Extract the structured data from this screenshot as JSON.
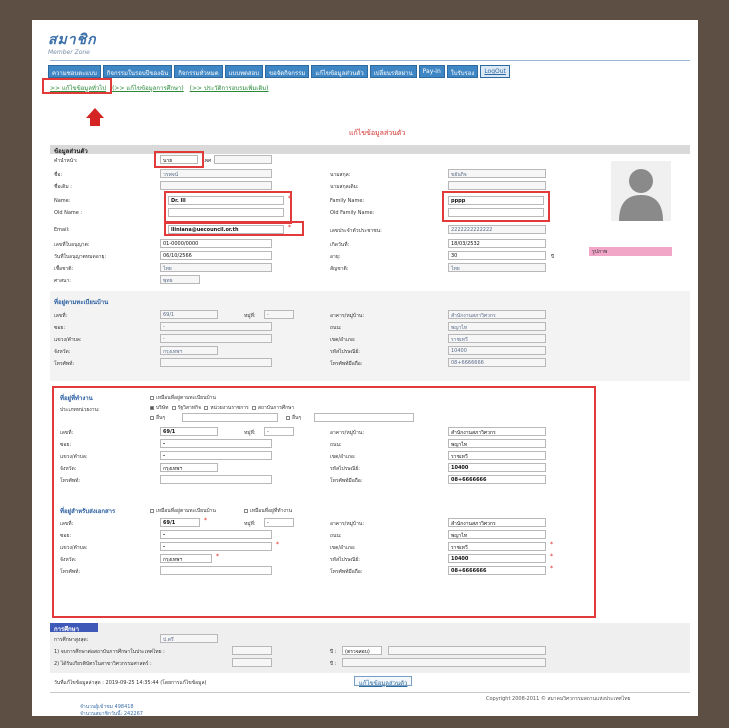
{
  "logo": {
    "title": "สมาชิก",
    "subtitle": "Member Zone"
  },
  "nav": [
    "ความชอบตะแบบ",
    "กิจกรรมในรอบปีของฉัน",
    "กิจกรรมทั่วหมด",
    "แบบทดสอบ",
    "ขอจัดกิจกรรม",
    "แก้ไขข้อมูลส่วนตัว",
    "เปลี่ยนรหัสผ่าน",
    "Pay-in",
    "ใบรับรอง",
    "LogOut"
  ],
  "subtabs": [
    ">> แก้ไขข้อมูลทั่วไป",
    "(>> แก้ไขข้อมูลการศึกษา)",
    "(>> ประวัติการอบรมเพิ่มเติม)"
  ],
  "heading": "แก้ไขข้อมูลส่วนตัว",
  "personal": {
    "section": "ข้อมูลส่วนตัว",
    "prefix_label": "คำนำหน้า:",
    "prefix_value": "นาย",
    "sex_label": "เพศ",
    "name_th_label": "ชื่อ:",
    "name_th_value": "วรพจน์",
    "lastname_th_label": "นามสกุล:",
    "lastname_th_value": "ขยันกิจ",
    "name_en_label2": "ชื่อเดิม :",
    "lastname_en_label2": "นามสกุลเดิม:",
    "name_label": "Name:",
    "name_value": "Dr.   lll",
    "family_label": "Family Name:",
    "family_value": "pppp",
    "oldname_label": "Old Name :",
    "oldfamily_label": "Old Family Name:",
    "email_label": "Email:",
    "email_value": "lliniana@uecouncil.or.th",
    "idcard_label": "เลขประจำตัวประชาชน:",
    "idcard_value": "2222222222222",
    "member_no_label": "เลขที่ใบอนุญาต:",
    "member_no_value": "01-0000/0000",
    "birth_label": "เกิดวันที่:",
    "birth_value": "18/03/2532",
    "issue_label": "วันที่ใบอนุญาตหมดอายุ:",
    "issue_value": "06/10/2566",
    "age_label": "อายุ:",
    "age_value": "30",
    "age_unit": "ปี",
    "nation_label": "เชื้อชาติ:",
    "nation_value": "ไทย",
    "citizen_label": "สัญชาติ:",
    "citizen_value": "ไทย",
    "religion_label": "ศาสนา:",
    "religion_value": "พุทธ",
    "status_label": "รูปภาพ"
  },
  "address": {
    "section": "ที่อยู่ตามทะเบียนบ้าน",
    "no_label": "เลขที่:",
    "no_value": "69/1",
    "moo_label": "หมู่ที่:",
    "moo_value": "-",
    "building_label": "อาคาร/หมู่บ้าน:",
    "building_value": "สำนักงานสภาวิศวกร",
    "soi_label": "ซอย:",
    "soi_value": "-",
    "road_label": "ถนน:",
    "road_value": "พญาไท",
    "subdist_label": "แขวง/ตำบล:",
    "subdist_value": "-",
    "dist_label": "เขต/อำเภอ:",
    "dist_value": "ราชเทวี",
    "prov_label": "จังหวัด:",
    "prov_value": "กรุงเทพฯ",
    "zip_label": "รหัสไปรษณีย์:",
    "zip_value": "10400",
    "tel_label": "โทรศัพท์:",
    "mobile_label": "โทรศัพท์มือถือ:",
    "mobile_value": "08+6666666"
  },
  "work": {
    "section": "ที่อยู่ที่ทำงาน",
    "same_label": "เหมือนที่อยู่ตามทะเบียนบ้าน",
    "type_label": "ประเภทหน่วยงาน:",
    "types": [
      "บริษัท",
      "รัฐวิสาหกิจ",
      "หน่วยงานราชการ",
      "สถาบันการศึกษา",
      "อื่นๆ"
    ],
    "other_label": "อื่นๆ",
    "no_value": "69/1",
    "moo_value": "-",
    "building_value": "สำนักงานสภาวิศวกร",
    "soi_value": "-",
    "road_value": "พญาไท",
    "subdist_value": "-",
    "dist_value": "ราชเทวี",
    "prov_value": "กรุงเทพฯ",
    "zip_value": "10400",
    "mobile_value": "08+6666666"
  },
  "mail": {
    "section": "ที่อยู่สำหรับส่งเอกสาร",
    "opt1": "เหมือนที่อยู่ตามทะเบียนบ้าน",
    "opt2": "เหมือนที่อยู่ที่ทำงาน",
    "no_value": "69/1",
    "moo_value": "-",
    "building_value": "สำนักงานสภาวิศวกร",
    "soi_value": "-",
    "road_value": "พญาไท",
    "subdist_value": "-",
    "dist_value": "ราชเทวี",
    "prov_value": "กรุงเทพฯ",
    "zip_value": "10400",
    "mobile_value": "08+6666666"
  },
  "edu": {
    "section": "การศึกษา",
    "level_label": "การศึกษาสูงสุด:",
    "level_value": "ป.ตรี",
    "q1": "1) จบการศึกษาต่อสถาบันการศึกษาในประเทศไทย :",
    "q1_year": "ปี :",
    "q1_sel": "(ตรวจสอบ)",
    "q2": "2) ได้รับเกียรติบัตรในสาขาวิศวกรรมศาสตร์ :",
    "q2_year": "ปี :",
    "updated": "วันที่แก้ไขข้อมูลล่าสุด : 2019-09-25 14:35:44 (โดยการแก้ไขข้อมูล)"
  },
  "save_label": "แก้ไขข้อมูลส่วนตัว",
  "copyright": "Copyright 2008-2011 © สมาคมวิศวกรรมสถานแห่งประเทศไทย",
  "counter1": "จำนวนผู้เข้าชม 498418",
  "counter2": "จำนวนสมาชิกวันนี้: 242267",
  "colors": {
    "nav": "#3f86c4",
    "highlight": "#e03a3a",
    "pink": "#f2a6c7",
    "edu": "#3f59b8"
  }
}
